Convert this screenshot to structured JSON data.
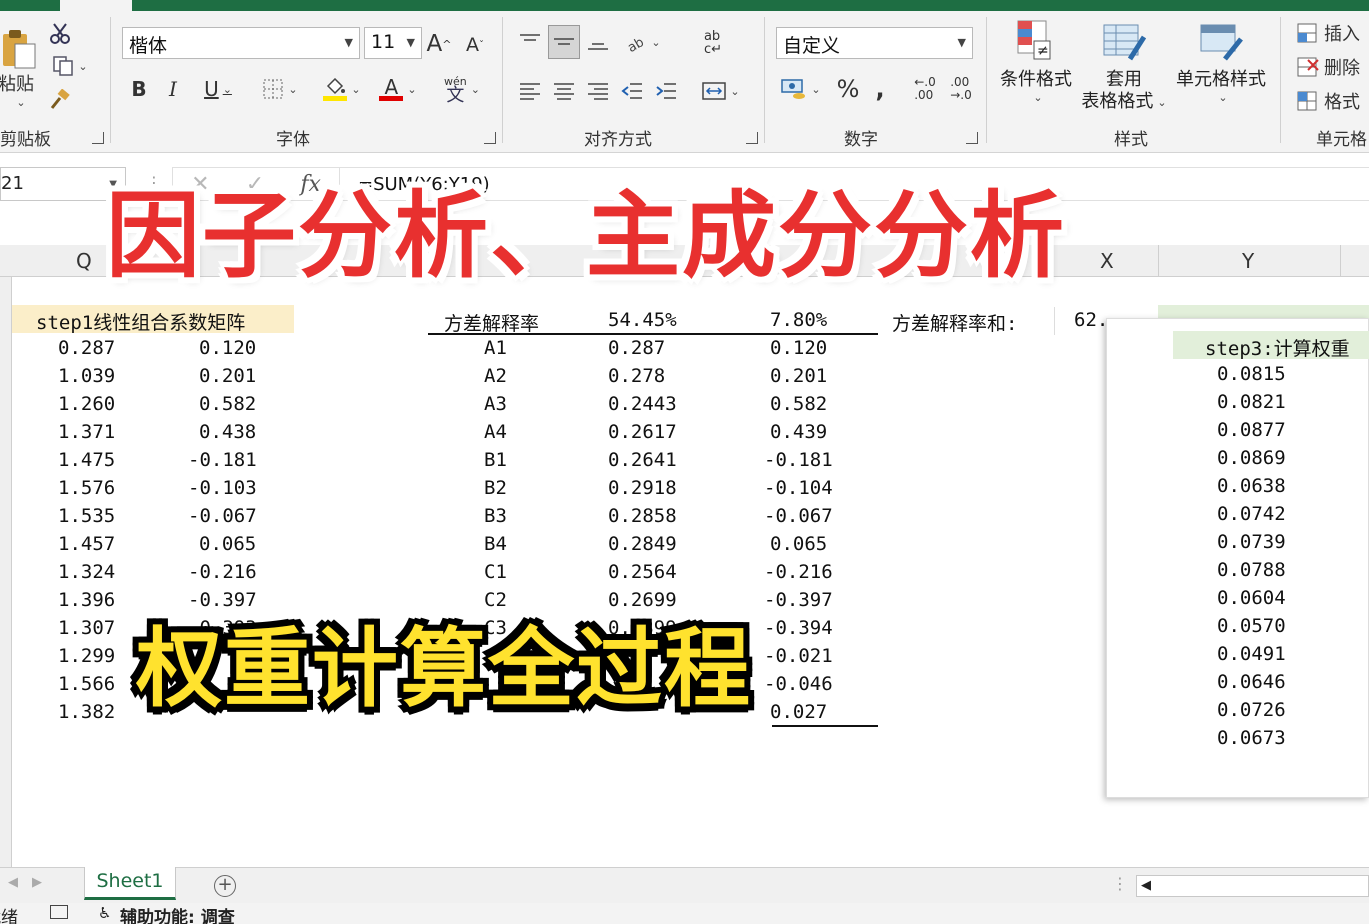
{
  "ribbon": {
    "clipboard": {
      "paste_label": "粘贴",
      "group_label": "剪贴板"
    },
    "font": {
      "font_name": "楷体",
      "font_size": "11",
      "grow_label": "A",
      "shrink_label": "A",
      "bold_label": "B",
      "italic_label": "I",
      "underline_label": "U",
      "fill_color": "#ffe600",
      "font_color": "#e00000",
      "color_letter": "A",
      "phonetic_top": "wén",
      "phonetic_bottom": "文",
      "group_label": "字体"
    },
    "alignment": {
      "group_label": "对齐方式",
      "wrap_top": "ab",
      "wrap_bottom": "c↵"
    },
    "number": {
      "format": "自定义",
      "percent_label": "%",
      "comma_label": ",",
      "inc_decimal_top": "←.0",
      "inc_decimal_bottom": ".00",
      "dec_decimal_top": ".00",
      "dec_decimal_bottom": "→.0",
      "group_label": "数字"
    },
    "styles": {
      "conditional_label": "条件格式",
      "table_label_1": "套用",
      "table_label_2": "表格格式",
      "cell_style_label": "单元格样式",
      "group_label": "样式"
    },
    "cells": {
      "insert_label": "插入",
      "delete_label": "删除",
      "format_label": "格式",
      "group_label": "单元格"
    }
  },
  "formula_bar": {
    "name_box": "21",
    "cancel_icon": "✕",
    "enter_icon": "✓",
    "fx_label": "fx",
    "formula": "=SUM(Y6:Y19)"
  },
  "columns": {
    "q": "Q",
    "x": "X",
    "y": "Y"
  },
  "sheet": {
    "step1_label": "step1线性组合系数矩阵",
    "step1_rows": [
      [
        "0.287",
        "0.120"
      ],
      [
        "1.039",
        "0.201"
      ],
      [
        "1.260",
        "0.582"
      ],
      [
        "1.371",
        "0.438"
      ],
      [
        "1.475",
        "-0.181"
      ],
      [
        "1.576",
        "-0.103"
      ],
      [
        "1.535",
        "-0.067"
      ],
      [
        "1.457",
        "0.065"
      ],
      [
        "1.324",
        "-0.216"
      ],
      [
        "1.396",
        "-0.397"
      ],
      [
        "1.307",
        "-0.393"
      ],
      [
        "1.299",
        ""
      ],
      [
        "1.566",
        "0"
      ],
      [
        "1.382",
        ""
      ]
    ],
    "table2_header": [
      "方差解释率",
      "54.45%",
      "7.80%"
    ],
    "table2_rows": [
      [
        "A1",
        "0.287",
        "0.120"
      ],
      [
        "A2",
        "0.278",
        "0.201"
      ],
      [
        "A3",
        "0.2443",
        "0.582"
      ],
      [
        "A4",
        "0.2617",
        "0.439"
      ],
      [
        "B1",
        "0.2641",
        "-0.181"
      ],
      [
        "B2",
        "0.2918",
        "-0.104"
      ],
      [
        "B3",
        "0.2858",
        "-0.067"
      ],
      [
        "B4",
        "0.2849",
        "0.065"
      ],
      [
        "C1",
        "0.2564",
        "-0.216"
      ],
      [
        "C2",
        "0.2699",
        "-0.397"
      ],
      [
        "C3",
        "0.2399",
        "-0.394"
      ],
      [
        "",
        "",
        "-0.021"
      ],
      [
        "",
        "",
        "-0.046"
      ],
      [
        "",
        "",
        "0.027"
      ]
    ],
    "variance_sum_label": "方差解释率和:",
    "variance_sum_value": "62.",
    "step3_label": "step3:计算权重",
    "weights": [
      "0.0815",
      "0.0821",
      "0.0877",
      "0.0869",
      "0.0638",
      "0.0742",
      "0.0739",
      "0.0788",
      "0.0604",
      "0.0570",
      "0.0491",
      "0.0646",
      "0.0726",
      "0.0673"
    ]
  },
  "overlay": {
    "title": "因子分析、主成分分析",
    "subtitle": "权重计算全过程"
  },
  "tabs": {
    "sheet1": "Sheet1",
    "add": "+"
  },
  "status": {
    "ready": "就绪",
    "accessibility": "辅助功能: 调查"
  }
}
